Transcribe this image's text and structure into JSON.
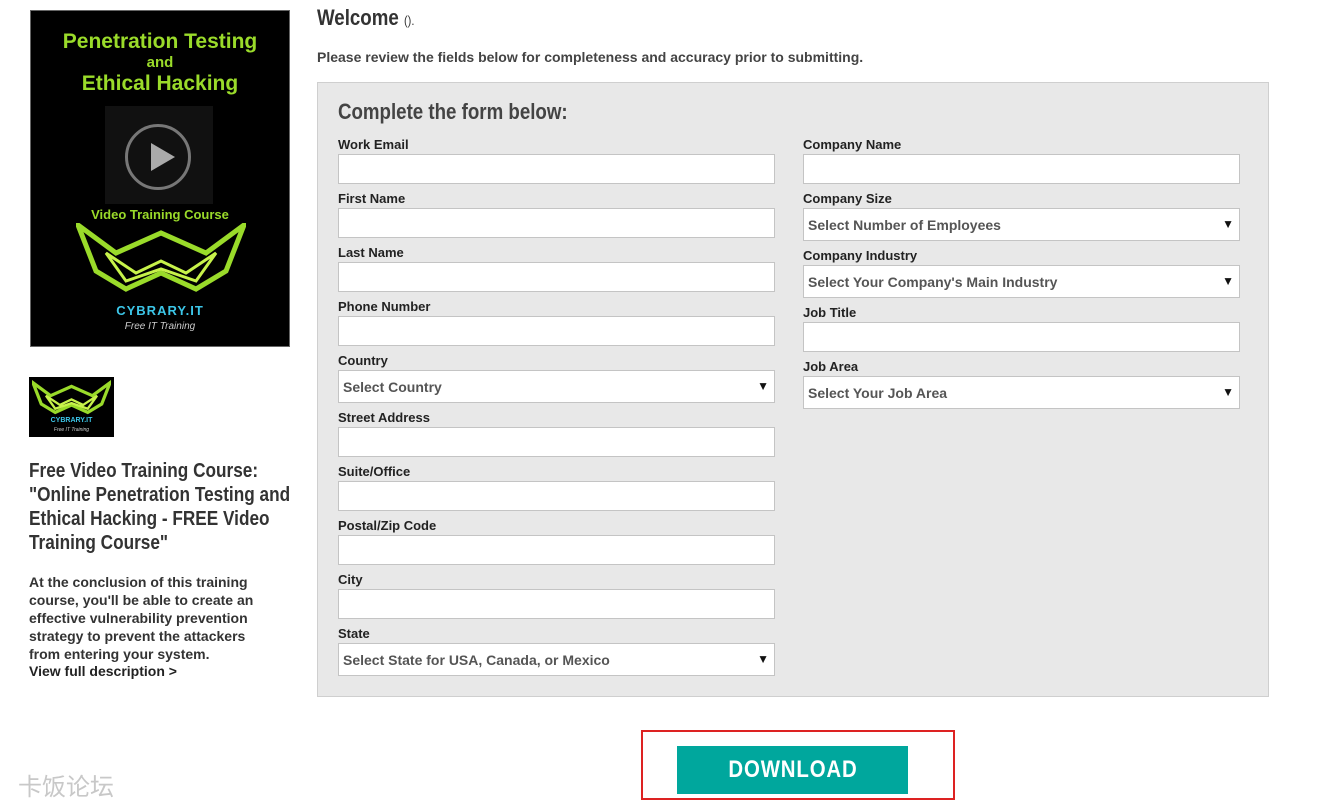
{
  "promo": {
    "title_line1": "Penetration Testing",
    "title_and": "and",
    "title_line2": "Ethical Hacking",
    "subtitle": "Video Training Course",
    "brand": "CYBRARY.IT",
    "tagline": "Free IT Training"
  },
  "thumb": {
    "brand": "CYBRARY.IT",
    "tagline": "Free IT Training"
  },
  "course": {
    "title": "Free Video Training Course: \"Online Penetration Testing and Ethical Hacking - FREE Video Training Course\"",
    "description": "At the conclusion of this training course, you'll be able to create an effective vulnerability prevention strategy to prevent the attackers from entering your system.",
    "view_link": "View full description >"
  },
  "header": {
    "welcome": "Welcome",
    "welcome_name": "().",
    "review": "Please review the fields below for completeness and accuracy prior to submitting."
  },
  "form": {
    "heading": "Complete the form below:",
    "left_fields": [
      {
        "label": "Work Email",
        "value": ""
      },
      {
        "label": "First Name",
        "value": ""
      },
      {
        "label": "Last Name",
        "value": ""
      },
      {
        "label": "Phone Number",
        "value": ""
      },
      {
        "label": "Country",
        "selected": "Select Country"
      },
      {
        "label": "Street Address",
        "value": ""
      },
      {
        "label": "Suite/Office",
        "value": ""
      },
      {
        "label": "Postal/Zip Code",
        "value": ""
      },
      {
        "label": "City",
        "value": ""
      },
      {
        "label": "State",
        "selected": "Select State for USA, Canada, or Mexico"
      }
    ],
    "right_fields": [
      {
        "label": "Company Name",
        "value": ""
      },
      {
        "label": "Company Size",
        "selected": "Select Number of Employees"
      },
      {
        "label": "Company Industry",
        "selected": "Select Your Company's Main Industry"
      },
      {
        "label": "Job Title",
        "value": ""
      },
      {
        "label": "Job Area",
        "selected": "Select Your Job Area"
      }
    ],
    "arrow": "▼"
  },
  "download": {
    "label": "DOWNLOAD"
  },
  "watermark": "卡饭论坛",
  "colors": {
    "accent": "#00a79d",
    "highlight_border": "#dd2222",
    "panel_bg": "#e8e8e8",
    "promo_green": "#9adb2a",
    "promo_blue": "#3cc6e8"
  }
}
